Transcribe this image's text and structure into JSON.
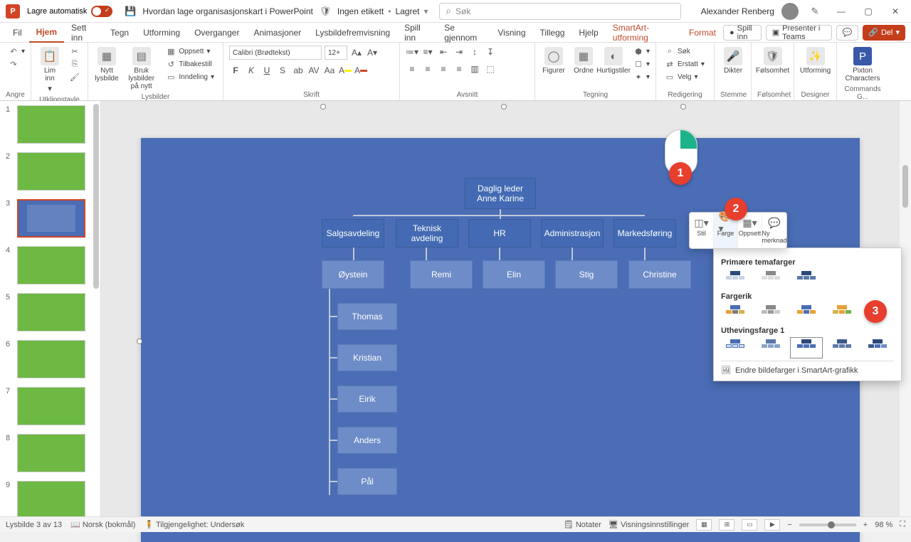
{
  "titlebar": {
    "autosave_label": "Lagre automatisk",
    "doc_title": "Hvordan lage organisasjonskart i PowerPoint",
    "no_label": "Ingen etikett",
    "saved": "Lagret",
    "search_placeholder": "Søk",
    "user": "Alexander Renberg"
  },
  "tabs": {
    "file": "Fil",
    "home": "Hjem",
    "insert": "Sett inn",
    "draw": "Tegn",
    "design": "Utforming",
    "transitions": "Overganger",
    "animations": "Animasjoner",
    "slideshow": "Lysbildefremvisning",
    "record": "Spill inn",
    "review": "Se gjennom",
    "view": "Visning",
    "addins": "Tillegg",
    "help": "Hjelp",
    "smartart": "SmartArt-utforming",
    "format": "Format",
    "rec_btn": "Spill inn",
    "present_teams": "Presenter i Teams",
    "share": "Del"
  },
  "ribbon": {
    "undo_grp": "Angre",
    "clipboard": {
      "paste": "Lim inn",
      "label": "Utklippstavle"
    },
    "slides": {
      "new": "Nytt lysbilde",
      "reuse": "Bruk lysbilder på nytt",
      "layout": "Oppsett",
      "reset": "Tilbakestill",
      "section": "Inndeling",
      "label": "Lysbilder"
    },
    "font": {
      "name": "Calibri (Brødtekst)",
      "size": "12+",
      "label": "Skrift"
    },
    "paragraph": {
      "label": "Avsnitt"
    },
    "drawing": {
      "shapes": "Figurer",
      "arrange": "Ordne",
      "quick": "Hurtigstiler",
      "label": "Tegning"
    },
    "editing": {
      "find": "Søk",
      "replace": "Erstatt",
      "select": "Velg",
      "label": "Redigering"
    },
    "voice": {
      "dictate": "Dikter",
      "label": "Stemme"
    },
    "sensitivity": {
      "btn": "Følsomhet",
      "label": "Følsomhet"
    },
    "designer": {
      "btn": "Utforming",
      "label": "Designer"
    },
    "pixton": {
      "btn": "Pixton Characters",
      "label": "Commands G..."
    }
  },
  "mini_toolbar": {
    "style": "Stil",
    "color": "Farge",
    "layout": "Oppsett",
    "comment": "Ny merknad"
  },
  "gallery": {
    "primary": "Primære temafarger",
    "colorful": "Fargerik",
    "accent1": "Uthevingsfarge 1",
    "change": "Endre bildefarger i SmartArt-grafikk"
  },
  "org": {
    "ceo_title": "Daglig leder",
    "ceo_name": "Anne Karine",
    "d1": "Salgsavdeling",
    "d2": "Teknisk avdeling",
    "d3": "HR",
    "d4": "Administrasjon",
    "d5": "Markedsføring",
    "p1": "Øystein",
    "p2": "Remi",
    "p3": "Elin",
    "p4": "Stig",
    "p5": "Christine",
    "s1": "Thomas",
    "s2": "Kristian",
    "s3": "Eirik",
    "s4": "Anders",
    "s5": "Pål"
  },
  "status": {
    "slide": "Lysbilde 3 av 13",
    "lang": "Norsk (bokmål)",
    "access": "Tilgjengelighet: Undersøk",
    "notes": "Notater",
    "display": "Visningsinnstillinger",
    "zoom": "98 %"
  },
  "callouts": {
    "c1": "1",
    "c2": "2",
    "c3": "3"
  }
}
